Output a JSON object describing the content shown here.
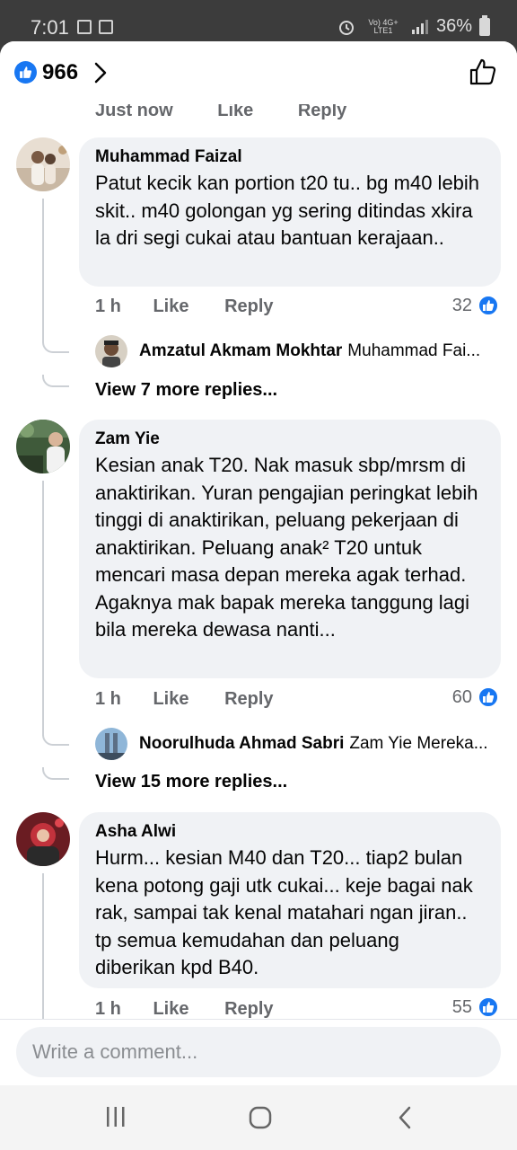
{
  "status_bar": {
    "time": "7:01",
    "network": "Vo) 4G+ LTE1",
    "battery": "36%"
  },
  "header": {
    "likes_count": "966"
  },
  "cut_off_actions": [
    "Just now",
    "Like",
    "Reply"
  ],
  "comments": [
    {
      "name": "Muhammad Faizal",
      "text": "Patut kecik kan portion t20 tu.. bg m40 lebih skit.. m40 golongan yg sering ditindas xkira la dri segi cukai atau bantuan kerajaan..",
      "time": "1 h",
      "like_label": "Like",
      "reply_label": "Reply",
      "reactions": "32",
      "reply_preview": {
        "name": "Amzatul Akmam Mokhtar",
        "text": "Muhammad Fai..."
      },
      "view_more": "View 7 more replies..."
    },
    {
      "name": "Zam Yie",
      "text": "Kesian anak T20. Nak masuk sbp/mrsm di anaktirikan. Yuran pengajian peringkat lebih tinggi di anaktirikan, peluang pekerjaan di anaktirikan. Peluang anak² T20 untuk mencari masa depan mereka agak terhad. Agaknya mak bapak mereka tanggung lagi bila mereka dewasa nanti...",
      "time": "1 h",
      "like_label": "Like",
      "reply_label": "Reply",
      "reactions": "60",
      "reply_preview": {
        "name": "Noorulhuda Ahmad Sabri",
        "text": "Zam Yie Mereka..."
      },
      "view_more": "View 15 more replies..."
    },
    {
      "name": "Asha Alwi",
      "text": "Hurm... kesian M40 dan T20... tiap2 bulan kena potong gaji utk cukai... keje bagai nak rak, sampai tak kenal matahari ngan jiran.. tp semua kemudahan dan peluang diberikan kpd B40.",
      "time": "1 h",
      "like_label": "Like",
      "reply_label": "Reply",
      "reactions": "55"
    }
  ],
  "composer": {
    "placeholder": "Write a comment..."
  },
  "colors": {
    "accent": "#1877f2",
    "bubble": "#f0f2f5",
    "meta_text": "#65676b"
  }
}
